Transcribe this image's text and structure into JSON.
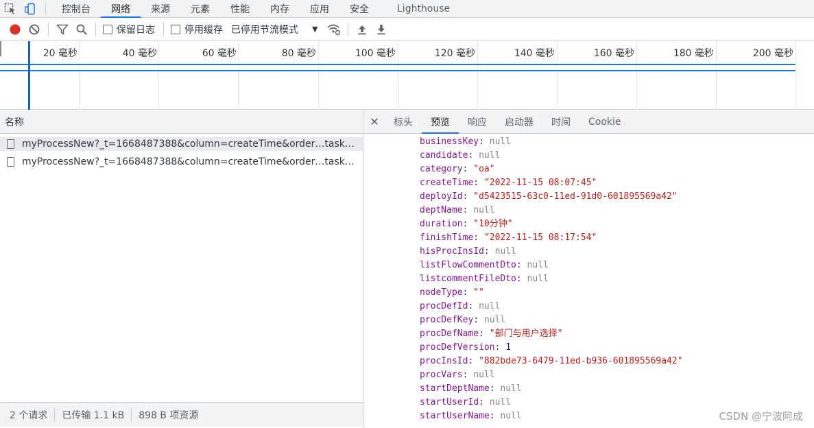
{
  "top_tabs": [
    "控制台",
    "网络",
    "来源",
    "元素",
    "性能",
    "内存",
    "应用",
    "安全",
    "Lighthouse"
  ],
  "active_top_tab": "网络",
  "toolbar": {
    "preserve_log": "保留日志",
    "disable_cache": "停用缓存",
    "throttling": "已停用节流模式"
  },
  "timeline": {
    "ticks": [
      "20 毫秒",
      "40 毫秒",
      "60 毫秒",
      "80 毫秒",
      "100 毫秒",
      "120 毫秒",
      "140 毫秒",
      "160 毫秒",
      "180 毫秒",
      "200 毫秒"
    ]
  },
  "requests": {
    "header": "名称",
    "rows": [
      "myProcessNew?_t=1668487388&column=createTime&order…taskName…",
      "myProcessNew?_t=1668487388&column=createTime&order…taskName…"
    ]
  },
  "status": {
    "requests": "2 个请求",
    "transferred": "已传输 1.1 kB",
    "resources": "898 B 项资源"
  },
  "detail_tabs": [
    "标头",
    "预览",
    "响应",
    "启动器",
    "时间",
    "Cookie"
  ],
  "active_detail_tab": "预览",
  "preview": [
    {
      "key": "businessKey",
      "value": "null",
      "type": "null"
    },
    {
      "key": "candidate",
      "value": "null",
      "type": "null"
    },
    {
      "key": "category",
      "value": "\"oa\"",
      "type": "str"
    },
    {
      "key": "createTime",
      "value": "\"2022-11-15 08:07:45\"",
      "type": "str"
    },
    {
      "key": "deployId",
      "value": "\"d5423515-63c0-11ed-91d0-601895569a42\"",
      "type": "str"
    },
    {
      "key": "deptName",
      "value": "null",
      "type": "null"
    },
    {
      "key": "duration",
      "value": "\"10分钟\"",
      "type": "str"
    },
    {
      "key": "finishTime",
      "value": "\"2022-11-15 08:17:54\"",
      "type": "str"
    },
    {
      "key": "hisProcInsId",
      "value": "null",
      "type": "null"
    },
    {
      "key": "listFlowCommentDto",
      "value": "null",
      "type": "null"
    },
    {
      "key": "listcommentFileDto",
      "value": "null",
      "type": "null"
    },
    {
      "key": "nodeType",
      "value": "\"\"",
      "type": "str"
    },
    {
      "key": "procDefId",
      "value": "null",
      "type": "null"
    },
    {
      "key": "procDefKey",
      "value": "null",
      "type": "null"
    },
    {
      "key": "procDefName",
      "value": "\"部门与用户选择\"",
      "type": "str"
    },
    {
      "key": "procDefVersion",
      "value": "1",
      "type": "num"
    },
    {
      "key": "procInsId",
      "value": "\"882bde73-6479-11ed-b936-601895569a42\"",
      "type": "str"
    },
    {
      "key": "procVars",
      "value": "null",
      "type": "null"
    },
    {
      "key": "startDeptName",
      "value": "null",
      "type": "null"
    },
    {
      "key": "startUserId",
      "value": "null",
      "type": "null"
    },
    {
      "key": "startUserName",
      "value": "null",
      "type": "null"
    }
  ],
  "watermark": "CSDN @宁波阿成",
  "colors": {
    "accent": "#1a73e8",
    "record": "#d93025",
    "json_key": "#881391",
    "json_string": "#c41a16",
    "json_null": "#80868b"
  }
}
